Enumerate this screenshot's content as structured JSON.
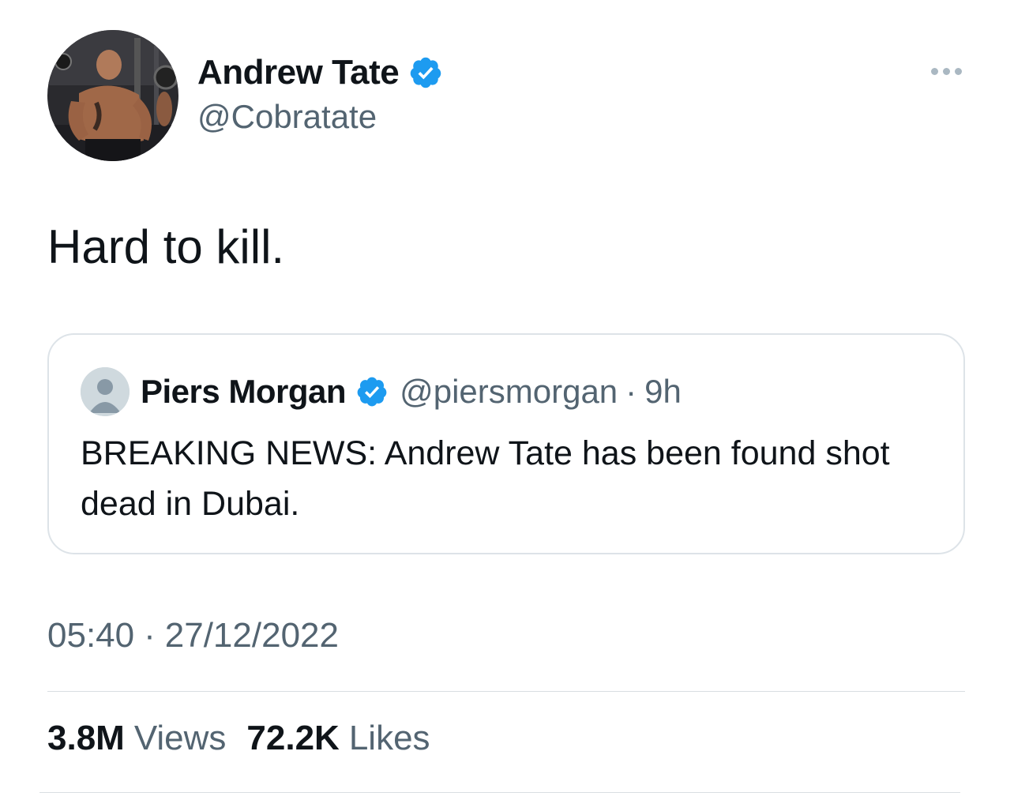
{
  "tweet": {
    "author": {
      "name": "Andrew Tate",
      "handle": "@Cobratate",
      "verified": true,
      "avatar_icon": "profile-photo"
    },
    "more_icon": "more-options-icon",
    "text": "Hard to kill.",
    "quoted": {
      "author_name": "Piers Morgan",
      "author_handle": "@piersmorgan",
      "separator": "·",
      "time_ago": "9h",
      "verified": true,
      "avatar_icon": "default-avatar-icon",
      "text": "BREAKING NEWS: Andrew Tate has been found shot dead in Dubai."
    },
    "timestamp": {
      "time": "05:40",
      "separator": "·",
      "date": "27/12/2022"
    },
    "stats": {
      "views_count": "3.8M",
      "views_label": "Views",
      "likes_count": "72.2K",
      "likes_label": "Likes"
    }
  },
  "colors": {
    "verified_blue": "#1d9bf0",
    "secondary_text": "#536471",
    "primary_text": "#0f1419",
    "border": "#dde3e8"
  }
}
